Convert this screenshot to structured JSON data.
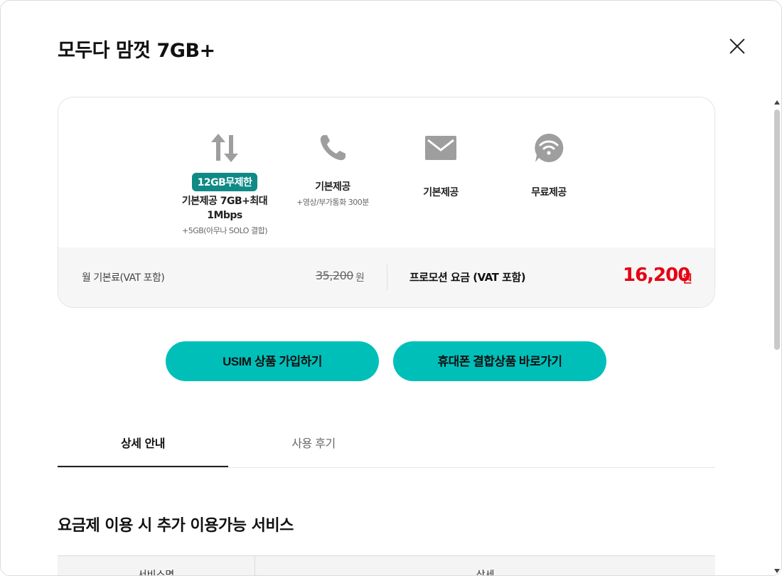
{
  "modal": {
    "title": "모두다 맘껏 7GB+"
  },
  "features": [
    {
      "icon": "data-transfer-icon",
      "badge": "12GB무제한",
      "main": "기본제공 7GB+최대1Mbps",
      "sub": "+5GB(아무나 SOLO 결합)"
    },
    {
      "icon": "phone-icon",
      "main": "기본제공",
      "sub": "+영상/부가통화 300분"
    },
    {
      "icon": "mail-icon",
      "main": "기본제공"
    },
    {
      "icon": "wifi-chat-icon",
      "main": "무료제공"
    }
  ],
  "pricing": {
    "monthly_label": "월 기본료(VAT 포함)",
    "original_price": "35,200",
    "original_unit": "원",
    "promo_label": "프로모션 요금 (VAT 포함)",
    "promo_price": "16,200",
    "promo_unit": "원",
    "promo_color": "#e60012"
  },
  "buttons": {
    "usim": "USIM 상품 가입하기",
    "phone_bundle": "휴대폰 결합상품 바로가기",
    "accent": "#00bfb9"
  },
  "tabs": [
    {
      "label": "상세 안내",
      "active": true
    },
    {
      "label": "사용 후기",
      "active": false
    }
  ],
  "section": {
    "title": "요금제 이용 시 추가 이용가능 서비스",
    "table_headers": [
      "서비스명",
      "상세"
    ]
  }
}
